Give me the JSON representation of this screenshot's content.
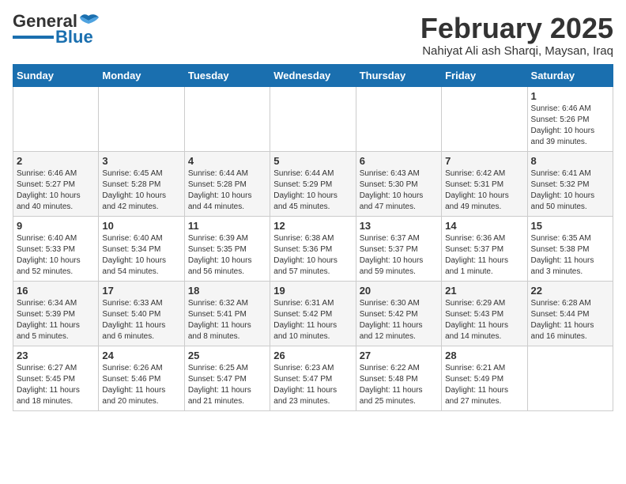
{
  "logo": {
    "general": "General",
    "blue": "Blue"
  },
  "title": "February 2025",
  "location": "Nahiyat Ali ash Sharqi, Maysan, Iraq",
  "headers": [
    "Sunday",
    "Monday",
    "Tuesday",
    "Wednesday",
    "Thursday",
    "Friday",
    "Saturday"
  ],
  "weeks": [
    [
      {
        "day": "",
        "info": ""
      },
      {
        "day": "",
        "info": ""
      },
      {
        "day": "",
        "info": ""
      },
      {
        "day": "",
        "info": ""
      },
      {
        "day": "",
        "info": ""
      },
      {
        "day": "",
        "info": ""
      },
      {
        "day": "1",
        "info": "Sunrise: 6:46 AM\nSunset: 5:26 PM\nDaylight: 10 hours\nand 39 minutes."
      }
    ],
    [
      {
        "day": "2",
        "info": "Sunrise: 6:46 AM\nSunset: 5:27 PM\nDaylight: 10 hours\nand 40 minutes."
      },
      {
        "day": "3",
        "info": "Sunrise: 6:45 AM\nSunset: 5:28 PM\nDaylight: 10 hours\nand 42 minutes."
      },
      {
        "day": "4",
        "info": "Sunrise: 6:44 AM\nSunset: 5:28 PM\nDaylight: 10 hours\nand 44 minutes."
      },
      {
        "day": "5",
        "info": "Sunrise: 6:44 AM\nSunset: 5:29 PM\nDaylight: 10 hours\nand 45 minutes."
      },
      {
        "day": "6",
        "info": "Sunrise: 6:43 AM\nSunset: 5:30 PM\nDaylight: 10 hours\nand 47 minutes."
      },
      {
        "day": "7",
        "info": "Sunrise: 6:42 AM\nSunset: 5:31 PM\nDaylight: 10 hours\nand 49 minutes."
      },
      {
        "day": "8",
        "info": "Sunrise: 6:41 AM\nSunset: 5:32 PM\nDaylight: 10 hours\nand 50 minutes."
      }
    ],
    [
      {
        "day": "9",
        "info": "Sunrise: 6:40 AM\nSunset: 5:33 PM\nDaylight: 10 hours\nand 52 minutes."
      },
      {
        "day": "10",
        "info": "Sunrise: 6:40 AM\nSunset: 5:34 PM\nDaylight: 10 hours\nand 54 minutes."
      },
      {
        "day": "11",
        "info": "Sunrise: 6:39 AM\nSunset: 5:35 PM\nDaylight: 10 hours\nand 56 minutes."
      },
      {
        "day": "12",
        "info": "Sunrise: 6:38 AM\nSunset: 5:36 PM\nDaylight: 10 hours\nand 57 minutes."
      },
      {
        "day": "13",
        "info": "Sunrise: 6:37 AM\nSunset: 5:37 PM\nDaylight: 10 hours\nand 59 minutes."
      },
      {
        "day": "14",
        "info": "Sunrise: 6:36 AM\nSunset: 5:37 PM\nDaylight: 11 hours\nand 1 minute."
      },
      {
        "day": "15",
        "info": "Sunrise: 6:35 AM\nSunset: 5:38 PM\nDaylight: 11 hours\nand 3 minutes."
      }
    ],
    [
      {
        "day": "16",
        "info": "Sunrise: 6:34 AM\nSunset: 5:39 PM\nDaylight: 11 hours\nand 5 minutes."
      },
      {
        "day": "17",
        "info": "Sunrise: 6:33 AM\nSunset: 5:40 PM\nDaylight: 11 hours\nand 6 minutes."
      },
      {
        "day": "18",
        "info": "Sunrise: 6:32 AM\nSunset: 5:41 PM\nDaylight: 11 hours\nand 8 minutes."
      },
      {
        "day": "19",
        "info": "Sunrise: 6:31 AM\nSunset: 5:42 PM\nDaylight: 11 hours\nand 10 minutes."
      },
      {
        "day": "20",
        "info": "Sunrise: 6:30 AM\nSunset: 5:42 PM\nDaylight: 11 hours\nand 12 minutes."
      },
      {
        "day": "21",
        "info": "Sunrise: 6:29 AM\nSunset: 5:43 PM\nDaylight: 11 hours\nand 14 minutes."
      },
      {
        "day": "22",
        "info": "Sunrise: 6:28 AM\nSunset: 5:44 PM\nDaylight: 11 hours\nand 16 minutes."
      }
    ],
    [
      {
        "day": "23",
        "info": "Sunrise: 6:27 AM\nSunset: 5:45 PM\nDaylight: 11 hours\nand 18 minutes."
      },
      {
        "day": "24",
        "info": "Sunrise: 6:26 AM\nSunset: 5:46 PM\nDaylight: 11 hours\nand 20 minutes."
      },
      {
        "day": "25",
        "info": "Sunrise: 6:25 AM\nSunset: 5:47 PM\nDaylight: 11 hours\nand 21 minutes."
      },
      {
        "day": "26",
        "info": "Sunrise: 6:23 AM\nSunset: 5:47 PM\nDaylight: 11 hours\nand 23 minutes."
      },
      {
        "day": "27",
        "info": "Sunrise: 6:22 AM\nSunset: 5:48 PM\nDaylight: 11 hours\nand 25 minutes."
      },
      {
        "day": "28",
        "info": "Sunrise: 6:21 AM\nSunset: 5:49 PM\nDaylight: 11 hours\nand 27 minutes."
      },
      {
        "day": "",
        "info": ""
      }
    ]
  ]
}
